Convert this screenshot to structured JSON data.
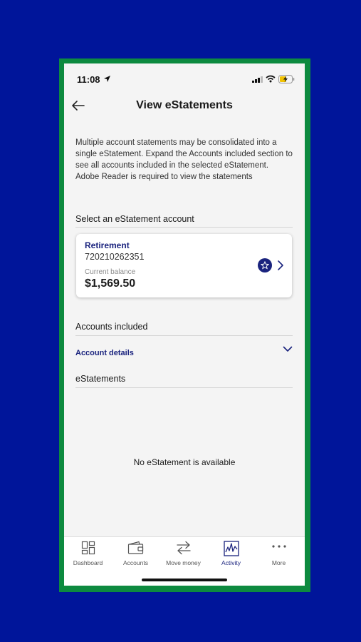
{
  "status_bar": {
    "time": "11:08"
  },
  "header": {
    "title": "View eStatements"
  },
  "intro_text": "Multiple account statements may be consolidated into a single eStatement. Expand the Accounts included section to see all accounts included in the selected eStatement. Adobe Reader is required to view the statements",
  "select_section": {
    "title": "Select an eStatement account"
  },
  "account_card": {
    "name": "Retirement",
    "number": "720210262351",
    "balance_label": "Current balance",
    "balance": "$1,569.50",
    "icon": "star-icon"
  },
  "accounts_included": {
    "title": "Accounts included",
    "details_label": "Account details"
  },
  "estatements": {
    "title": "eStatements",
    "empty_message": "No eStatement is available"
  },
  "tab_bar": {
    "tabs": [
      {
        "label": "Dashboard",
        "icon": "dashboard-icon"
      },
      {
        "label": "Accounts",
        "icon": "wallet-icon"
      },
      {
        "label": "Move money",
        "icon": "transfer-icon"
      },
      {
        "label": "Activity",
        "icon": "activity-icon",
        "active": true
      },
      {
        "label": "More",
        "icon": "more-icon"
      }
    ]
  },
  "colors": {
    "outer_background": "#00159a",
    "frame": "#0d8a3f",
    "accent": "#1a237e",
    "screen_background": "#f4f4f4"
  }
}
